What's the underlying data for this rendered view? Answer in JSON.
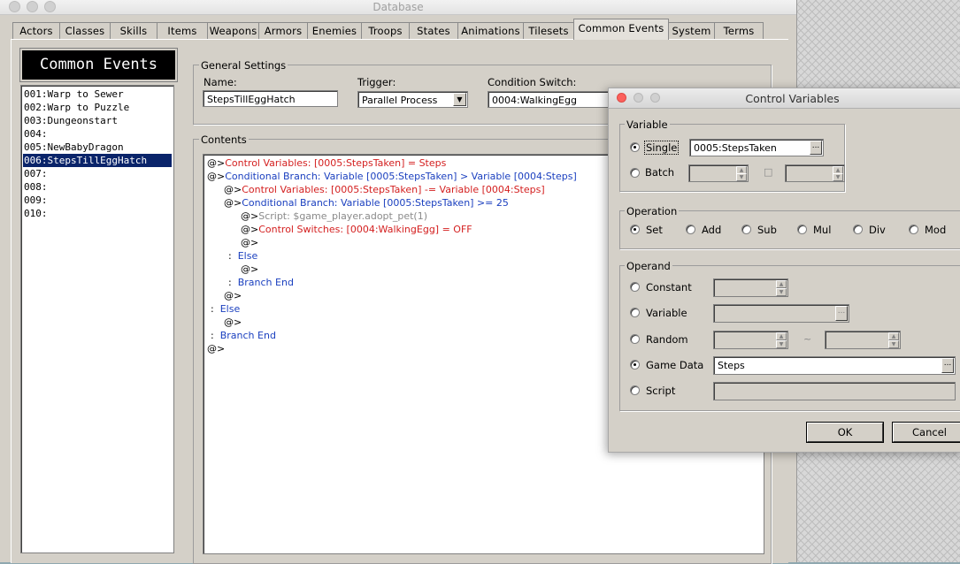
{
  "database_window": {
    "title": "Database",
    "tabs": [
      "Actors",
      "Classes",
      "Skills",
      "Items",
      "Weapons",
      "Armors",
      "Enemies",
      "Troops",
      "States",
      "Animations",
      "Tilesets",
      "Common Events",
      "System",
      "Terms"
    ],
    "active_tab": "Common Events"
  },
  "common_events": {
    "header": "Common Events",
    "items": [
      "001:Warp to Sewer",
      "002:Warp to Puzzle",
      "003:Dungeonstart",
      "004:",
      "005:NewBabyDragon",
      "006:StepsTillEggHatch",
      "007:",
      "008:",
      "009:",
      "010:"
    ],
    "selected": "006:StepsTillEggHatch"
  },
  "general_settings": {
    "group_label": "General Settings",
    "name_label": "Name:",
    "name_value": "StepsTillEggHatch",
    "trigger_label": "Trigger:",
    "trigger_value": "Parallel Process",
    "condition_switch_label": "Condition Switch:",
    "condition_switch_value": "0004:WalkingEgg"
  },
  "contents": {
    "group_label": "Contents",
    "lines": [
      {
        "prefix": "@>",
        "text": "Control Variables: [0005:StepsTaken] = Steps",
        "color": "red"
      },
      {
        "prefix": "@>",
        "text": "Conditional Branch: Variable [0005:StepsTaken] > Variable [0004:Steps]",
        "color": "blue"
      },
      {
        "prefix": "@>",
        "text": "Control Variables: [0005:StepsTaken] -= Variable [0004:Steps]",
        "color": "red"
      },
      {
        "prefix": "@>",
        "text": "Conditional Branch: Variable [0005:StepsTaken] >= 25",
        "color": "blue"
      },
      {
        "prefix": "@>",
        "text": "Script: $game_player.adopt_pet(1)",
        "color": "gray"
      },
      {
        "prefix": "@>",
        "text": "Control Switches: [0004:WalkingEgg] = OFF",
        "color": "red"
      },
      {
        "prefix": "@>",
        "text": "",
        "color": "black"
      },
      {
        "prefix": ":",
        "text": "Else",
        "color": "blue"
      },
      {
        "prefix": "@>",
        "text": "",
        "color": "black"
      },
      {
        "prefix": ":",
        "text": "Branch End",
        "color": "blue"
      },
      {
        "prefix": "@>",
        "text": "",
        "color": "black"
      },
      {
        "prefix": ":",
        "text": "Else",
        "color": "blue"
      },
      {
        "prefix": "@>",
        "text": "",
        "color": "black"
      },
      {
        "prefix": ":",
        "text": "Branch End",
        "color": "blue"
      },
      {
        "prefix": "@>",
        "text": "",
        "color": "black"
      }
    ]
  },
  "control_variables": {
    "title": "Control Variables",
    "variable_group": "Variable",
    "single_label": "Single",
    "single_value": "0005:StepsTaken",
    "batch_label": "Batch",
    "batch_separator": "□",
    "selected_variable_mode": "Single",
    "operation_group": "Operation",
    "operations": [
      "Set",
      "Add",
      "Sub",
      "Mul",
      "Div",
      "Mod"
    ],
    "selected_operation": "Set",
    "operand_group": "Operand",
    "operands": [
      "Constant",
      "Variable",
      "Random",
      "Game Data",
      "Script"
    ],
    "selected_operand": "Game Data",
    "random_separator": "~",
    "game_data_value": "Steps",
    "ok_label": "OK",
    "cancel_label": "Cancel",
    "ellipsis": "..."
  }
}
